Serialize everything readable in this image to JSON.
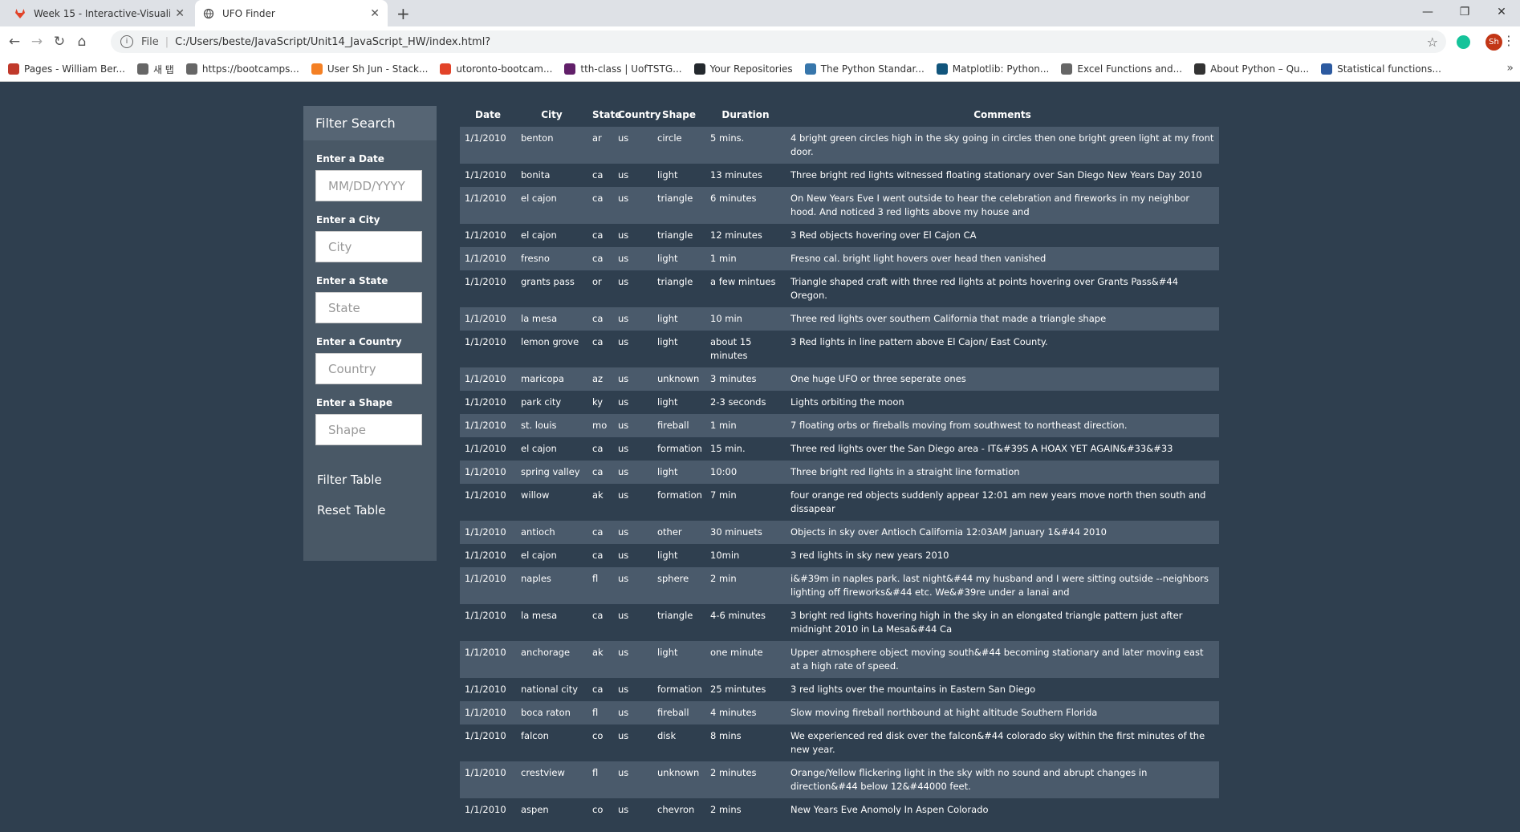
{
  "browser": {
    "tabs": [
      {
        "title": "Week 15 - Interactive-Visualizatic",
        "icon": "gitlab-icon",
        "active": false
      },
      {
        "title": "UFO Finder",
        "icon": "globe-icon",
        "active": true
      }
    ],
    "new_tab": "+",
    "url_prefix": "File",
    "url": "C:/Users/beste/JavaScript/Unit14_JavaScript_HW/index.html?",
    "avatar": "Sh",
    "bookmarks": [
      {
        "label": "Pages - William Ber...",
        "icon": "bookmark-icon",
        "color": "#c0392b"
      },
      {
        "label": "새 탭",
        "icon": "globe-icon",
        "color": "#666666"
      },
      {
        "label": "https://bootcamps...",
        "icon": "globe-icon",
        "color": "#666666"
      },
      {
        "label": "User Sh Jun - Stack...",
        "icon": "stackoverflow-icon",
        "color": "#f48024"
      },
      {
        "label": "utoronto-bootcam...",
        "icon": "gitlab-icon",
        "color": "#e24329"
      },
      {
        "label": "tth-class | UofTSTG...",
        "icon": "slack-icon",
        "color": "#611f69"
      },
      {
        "label": "Your Repositories",
        "icon": "github-icon",
        "color": "#24292e"
      },
      {
        "label": "The Python Standar...",
        "icon": "python-icon",
        "color": "#3776ab"
      },
      {
        "label": "Matplotlib: Python...",
        "icon": "matplotlib-icon",
        "color": "#11557c"
      },
      {
        "label": "Excel Functions and...",
        "icon": "globe-icon",
        "color": "#666666"
      },
      {
        "label": "About Python – Qu...",
        "icon": "pulse-icon",
        "color": "#333333"
      },
      {
        "label": "Statistical functions...",
        "icon": "scipy-icon",
        "color": "#2c5aa0"
      }
    ]
  },
  "sidebar": {
    "title": "Filter Search",
    "fields": [
      {
        "label": "Enter a Date",
        "placeholder": "MM/DD/YYYY"
      },
      {
        "label": "Enter a City",
        "placeholder": "City"
      },
      {
        "label": "Enter a State",
        "placeholder": "State"
      },
      {
        "label": "Enter a Country",
        "placeholder": "Country"
      },
      {
        "label": "Enter a Shape",
        "placeholder": "Shape"
      }
    ],
    "filter_button": "Filter Table",
    "reset_button": "Reset Table"
  },
  "table": {
    "headers": [
      "Date",
      "City",
      "State",
      "Country",
      "Shape",
      "Duration",
      "Comments"
    ],
    "rows": [
      [
        "1/1/2010",
        "benton",
        "ar",
        "us",
        "circle",
        "5 mins.",
        "4 bright green circles high in the sky going in circles then one bright green light at my front door."
      ],
      [
        "1/1/2010",
        "bonita",
        "ca",
        "us",
        "light",
        "13 minutes",
        "Three bright red lights witnessed floating stationary over San Diego New Years Day 2010"
      ],
      [
        "1/1/2010",
        "el cajon",
        "ca",
        "us",
        "triangle",
        "6 minutes",
        "On New Years Eve I went outside to hear the celebration and fireworks in my neighbor hood. And noticed 3 red lights above my house and"
      ],
      [
        "1/1/2010",
        "el cajon",
        "ca",
        "us",
        "triangle",
        "12 minutes",
        "3 Red objects hovering over El Cajon CA"
      ],
      [
        "1/1/2010",
        "fresno",
        "ca",
        "us",
        "light",
        "1 min",
        "Fresno cal. bright light hovers over head then vanished"
      ],
      [
        "1/1/2010",
        "grants pass",
        "or",
        "us",
        "triangle",
        "a few mintues",
        "Triangle shaped craft with three red lights at points hovering over Grants Pass&#44 Oregon."
      ],
      [
        "1/1/2010",
        "la mesa",
        "ca",
        "us",
        "light",
        "10 min",
        "Three red lights over southern California that made a triangle shape"
      ],
      [
        "1/1/2010",
        "lemon grove",
        "ca",
        "us",
        "light",
        "about 15 minutes",
        "3 Red lights in line pattern above El Cajon/ East County."
      ],
      [
        "1/1/2010",
        "maricopa",
        "az",
        "us",
        "unknown",
        "3 minutes",
        "One huge UFO or three seperate ones"
      ],
      [
        "1/1/2010",
        "park city",
        "ky",
        "us",
        "light",
        "2-3 seconds",
        "Lights orbiting the moon"
      ],
      [
        "1/1/2010",
        "st. louis",
        "mo",
        "us",
        "fireball",
        "1 min",
        "7 floating orbs or fireballs moving from southwest to northeast direction."
      ],
      [
        "1/1/2010",
        "el cajon",
        "ca",
        "us",
        "formation",
        "15 min.",
        "Three red lights over the San Diego area - IT&#39S A HOAX YET AGAIN&#33&#33"
      ],
      [
        "1/1/2010",
        "spring valley",
        "ca",
        "us",
        "light",
        "10:00",
        "Three bright red lights in a straight line formation"
      ],
      [
        "1/1/2010",
        "willow",
        "ak",
        "us",
        "formation",
        "7 min",
        "four orange red objects suddenly appear 12:01 am new years move north then south and dissapear"
      ],
      [
        "1/1/2010",
        "antioch",
        "ca",
        "us",
        "other",
        "30 minuets",
        "Objects in sky over Antioch California 12:03AM January 1&#44 2010"
      ],
      [
        "1/1/2010",
        "el cajon",
        "ca",
        "us",
        "light",
        "10min",
        "3 red lights in sky new years 2010"
      ],
      [
        "1/1/2010",
        "naples",
        "fl",
        "us",
        "sphere",
        "2 min",
        "i&#39m in naples park. last night&#44 my husband and I were sitting outside --neighbors lighting off fireworks&#44 etc. We&#39re under a lanai and"
      ],
      [
        "1/1/2010",
        "la mesa",
        "ca",
        "us",
        "triangle",
        "4-6 minutes",
        "3 bright red lights hovering high in the sky in an elongated triangle pattern just after midnight 2010 in La Mesa&#44 Ca"
      ],
      [
        "1/1/2010",
        "anchorage",
        "ak",
        "us",
        "light",
        "one minute",
        "Upper atmosphere object moving south&#44 becoming stationary and later moving east at a high rate of speed."
      ],
      [
        "1/1/2010",
        "national city",
        "ca",
        "us",
        "formation",
        "25 mintutes",
        "3 red lights over the mountains in Eastern San Diego"
      ],
      [
        "1/1/2010",
        "boca raton",
        "fl",
        "us",
        "fireball",
        "4 minutes",
        "Slow moving fireball northbound at hight altitude Southern Florida"
      ],
      [
        "1/1/2010",
        "falcon",
        "co",
        "us",
        "disk",
        "8 mins",
        "We experienced red disk over the falcon&#44 colorado sky within the first minutes of the new year."
      ],
      [
        "1/1/2010",
        "crestview",
        "fl",
        "us",
        "unknown",
        "2 minutes",
        "Orange/Yellow flickering light in the sky with no sound and abrupt changes in direction&#44 below 12&#44000 feet."
      ],
      [
        "1/1/2010",
        "aspen",
        "co",
        "us",
        "chevron",
        "2 mins",
        "New Years Eve Anomoly In Aspen Colorado"
      ]
    ]
  }
}
